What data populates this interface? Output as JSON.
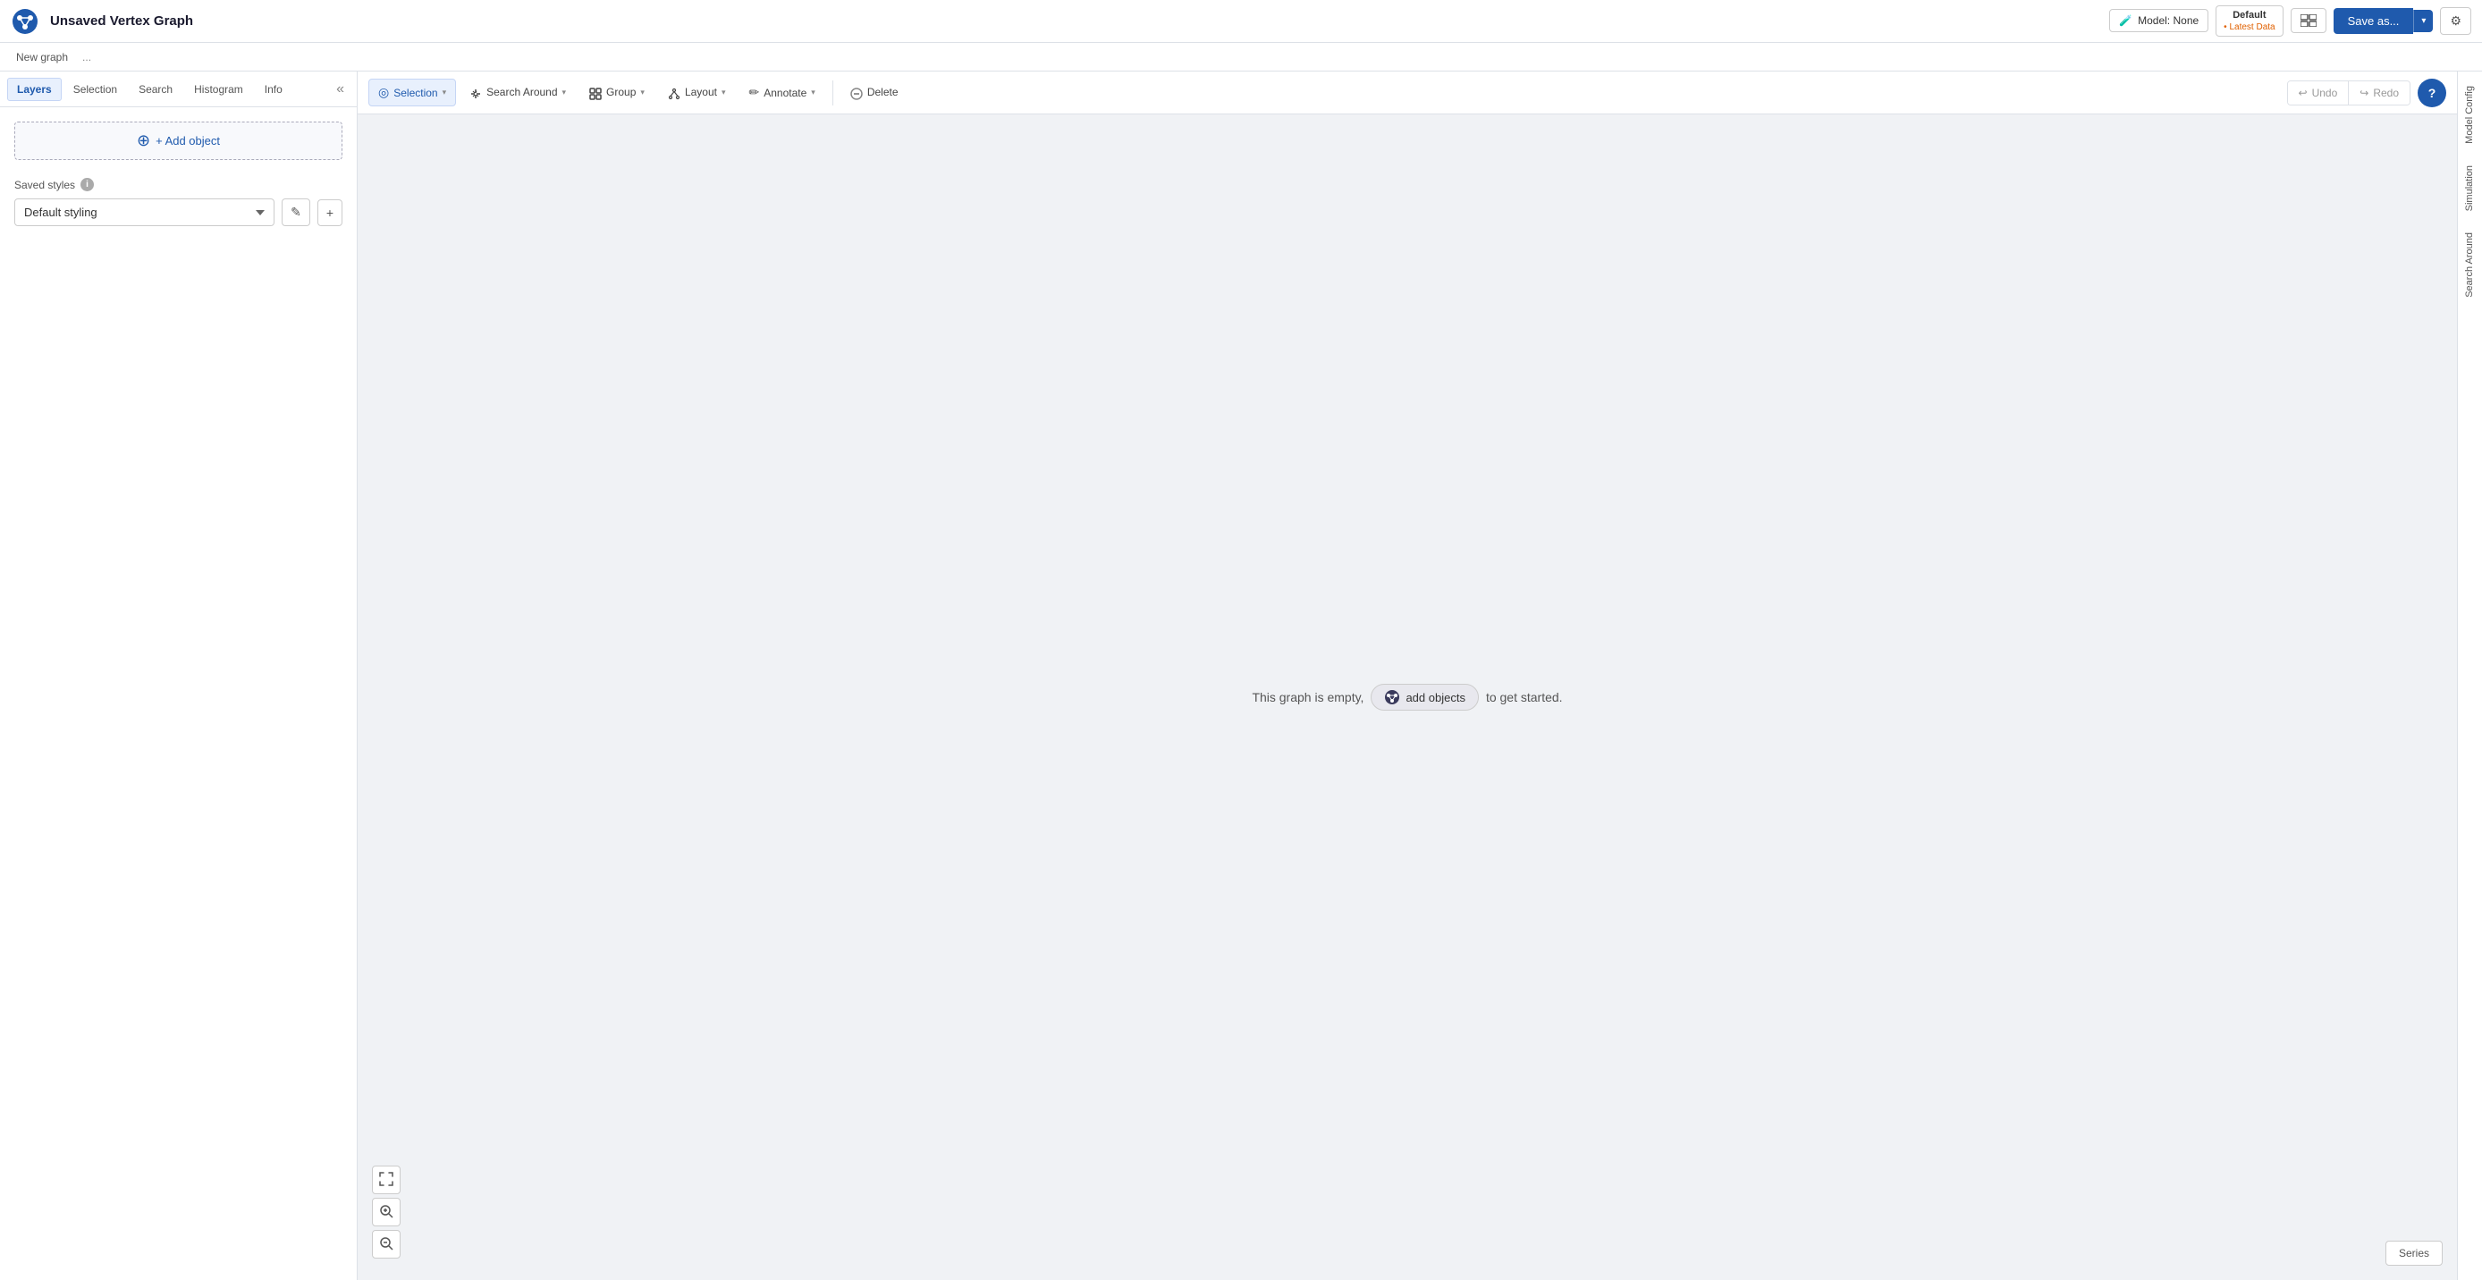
{
  "app": {
    "title": "Unsaved Vertex Graph",
    "logo_unicode": "◈"
  },
  "topbar": {
    "model_label": "Model: None",
    "default_data_label": "Default",
    "default_data_sub": "• Latest Data",
    "save_label": "Save as...",
    "dropdown_arrow": "▾",
    "gear_icon": "⚙"
  },
  "tabbar": {
    "items": [
      "New graph",
      "..."
    ]
  },
  "left_panel": {
    "tabs": [
      "Layers",
      "Selection",
      "Search",
      "Histogram",
      "Info"
    ],
    "active_tab": "Layers",
    "collapse_icon": "«",
    "add_object_label": "+ Add object",
    "saved_styles_label": "Saved styles",
    "info_icon": "i",
    "style_options": [
      "Default styling"
    ],
    "selected_style": "Default styling",
    "edit_icon": "✎",
    "add_icon": "+"
  },
  "toolbar": {
    "selection_label": "Selection",
    "selection_icon": "◎",
    "search_around_label": "Search Around",
    "search_around_icon": "✂",
    "group_label": "Group",
    "group_icon": "◻",
    "layout_label": "Layout",
    "layout_icon": "⊹",
    "annotate_label": "Annotate",
    "annotate_icon": "✏",
    "delete_label": "Delete",
    "delete_icon": "⊗",
    "undo_label": "Undo",
    "undo_icon": "↩",
    "redo_label": "Redo",
    "redo_icon": "↪",
    "help_label": "?"
  },
  "canvas": {
    "empty_message_prefix": "This graph is empty,",
    "add_objects_label": "add objects",
    "empty_message_suffix": "to get started.",
    "add_objects_icon": "◉"
  },
  "canvas_controls": {
    "fit_icon": "⤢",
    "zoom_in_icon": "+",
    "zoom_out_icon": "−"
  },
  "series_btn": "Series",
  "right_sidebar": {
    "items": [
      "Model Config",
      "Simulation",
      "Search Around"
    ]
  }
}
